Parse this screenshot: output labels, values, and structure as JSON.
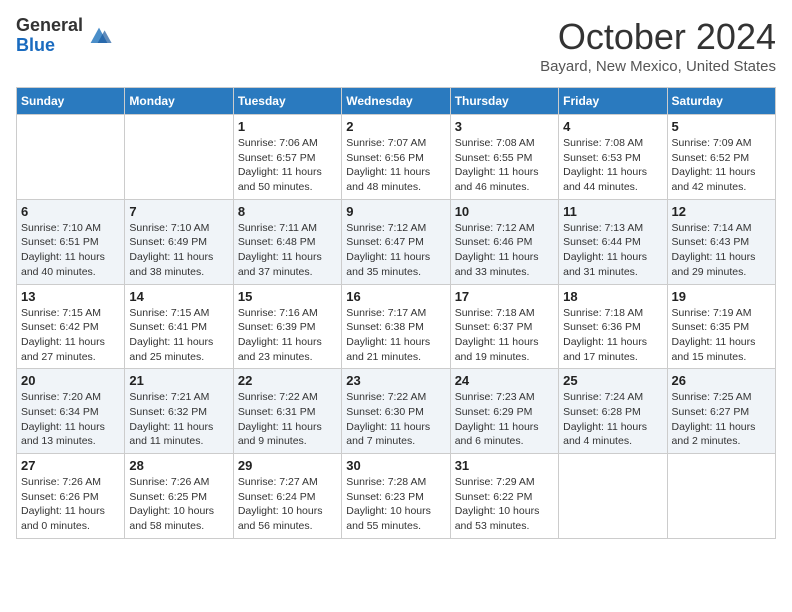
{
  "header": {
    "logo_general": "General",
    "logo_blue": "Blue",
    "month_title": "October 2024",
    "location": "Bayard, New Mexico, United States"
  },
  "calendar": {
    "days_of_week": [
      "Sunday",
      "Monday",
      "Tuesday",
      "Wednesday",
      "Thursday",
      "Friday",
      "Saturday"
    ],
    "weeks": [
      [
        {
          "day": "",
          "info": ""
        },
        {
          "day": "",
          "info": ""
        },
        {
          "day": "1",
          "info": "Sunrise: 7:06 AM\nSunset: 6:57 PM\nDaylight: 11 hours and 50 minutes."
        },
        {
          "day": "2",
          "info": "Sunrise: 7:07 AM\nSunset: 6:56 PM\nDaylight: 11 hours and 48 minutes."
        },
        {
          "day": "3",
          "info": "Sunrise: 7:08 AM\nSunset: 6:55 PM\nDaylight: 11 hours and 46 minutes."
        },
        {
          "day": "4",
          "info": "Sunrise: 7:08 AM\nSunset: 6:53 PM\nDaylight: 11 hours and 44 minutes."
        },
        {
          "day": "5",
          "info": "Sunrise: 7:09 AM\nSunset: 6:52 PM\nDaylight: 11 hours and 42 minutes."
        }
      ],
      [
        {
          "day": "6",
          "info": "Sunrise: 7:10 AM\nSunset: 6:51 PM\nDaylight: 11 hours and 40 minutes."
        },
        {
          "day": "7",
          "info": "Sunrise: 7:10 AM\nSunset: 6:49 PM\nDaylight: 11 hours and 38 minutes."
        },
        {
          "day": "8",
          "info": "Sunrise: 7:11 AM\nSunset: 6:48 PM\nDaylight: 11 hours and 37 minutes."
        },
        {
          "day": "9",
          "info": "Sunrise: 7:12 AM\nSunset: 6:47 PM\nDaylight: 11 hours and 35 minutes."
        },
        {
          "day": "10",
          "info": "Sunrise: 7:12 AM\nSunset: 6:46 PM\nDaylight: 11 hours and 33 minutes."
        },
        {
          "day": "11",
          "info": "Sunrise: 7:13 AM\nSunset: 6:44 PM\nDaylight: 11 hours and 31 minutes."
        },
        {
          "day": "12",
          "info": "Sunrise: 7:14 AM\nSunset: 6:43 PM\nDaylight: 11 hours and 29 minutes."
        }
      ],
      [
        {
          "day": "13",
          "info": "Sunrise: 7:15 AM\nSunset: 6:42 PM\nDaylight: 11 hours and 27 minutes."
        },
        {
          "day": "14",
          "info": "Sunrise: 7:15 AM\nSunset: 6:41 PM\nDaylight: 11 hours and 25 minutes."
        },
        {
          "day": "15",
          "info": "Sunrise: 7:16 AM\nSunset: 6:39 PM\nDaylight: 11 hours and 23 minutes."
        },
        {
          "day": "16",
          "info": "Sunrise: 7:17 AM\nSunset: 6:38 PM\nDaylight: 11 hours and 21 minutes."
        },
        {
          "day": "17",
          "info": "Sunrise: 7:18 AM\nSunset: 6:37 PM\nDaylight: 11 hours and 19 minutes."
        },
        {
          "day": "18",
          "info": "Sunrise: 7:18 AM\nSunset: 6:36 PM\nDaylight: 11 hours and 17 minutes."
        },
        {
          "day": "19",
          "info": "Sunrise: 7:19 AM\nSunset: 6:35 PM\nDaylight: 11 hours and 15 minutes."
        }
      ],
      [
        {
          "day": "20",
          "info": "Sunrise: 7:20 AM\nSunset: 6:34 PM\nDaylight: 11 hours and 13 minutes."
        },
        {
          "day": "21",
          "info": "Sunrise: 7:21 AM\nSunset: 6:32 PM\nDaylight: 11 hours and 11 minutes."
        },
        {
          "day": "22",
          "info": "Sunrise: 7:22 AM\nSunset: 6:31 PM\nDaylight: 11 hours and 9 minutes."
        },
        {
          "day": "23",
          "info": "Sunrise: 7:22 AM\nSunset: 6:30 PM\nDaylight: 11 hours and 7 minutes."
        },
        {
          "day": "24",
          "info": "Sunrise: 7:23 AM\nSunset: 6:29 PM\nDaylight: 11 hours and 6 minutes."
        },
        {
          "day": "25",
          "info": "Sunrise: 7:24 AM\nSunset: 6:28 PM\nDaylight: 11 hours and 4 minutes."
        },
        {
          "day": "26",
          "info": "Sunrise: 7:25 AM\nSunset: 6:27 PM\nDaylight: 11 hours and 2 minutes."
        }
      ],
      [
        {
          "day": "27",
          "info": "Sunrise: 7:26 AM\nSunset: 6:26 PM\nDaylight: 11 hours and 0 minutes."
        },
        {
          "day": "28",
          "info": "Sunrise: 7:26 AM\nSunset: 6:25 PM\nDaylight: 10 hours and 58 minutes."
        },
        {
          "day": "29",
          "info": "Sunrise: 7:27 AM\nSunset: 6:24 PM\nDaylight: 10 hours and 56 minutes."
        },
        {
          "day": "30",
          "info": "Sunrise: 7:28 AM\nSunset: 6:23 PM\nDaylight: 10 hours and 55 minutes."
        },
        {
          "day": "31",
          "info": "Sunrise: 7:29 AM\nSunset: 6:22 PM\nDaylight: 10 hours and 53 minutes."
        },
        {
          "day": "",
          "info": ""
        },
        {
          "day": "",
          "info": ""
        }
      ]
    ]
  }
}
